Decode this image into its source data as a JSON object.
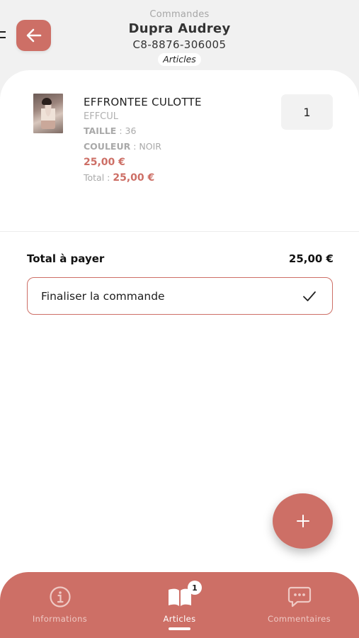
{
  "header": {
    "subtitle": "Commandes",
    "customer_name": "Dupra Audrey",
    "order_ref": "C8-8876-306005",
    "section_chip": "Articles"
  },
  "icons": {
    "back": "arrow-left-icon",
    "menu": "menu-icon",
    "check": "check-icon",
    "add": "plus-icon",
    "info": "info-icon",
    "articles": "book-icon",
    "comments": "chat-icon"
  },
  "colors": {
    "accent": "#cd6f66",
    "background": "#f1f1f1",
    "card": "#ffffff"
  },
  "items": [
    {
      "title": "EFFRONTEE CULOTTE",
      "code": "EFFCUL",
      "size_label": "TAILLE",
      "size_value": "36",
      "color_label": "COULEUR",
      "color_value": "NOIR",
      "price": "25,00 €",
      "total_label": "Total :",
      "total_value": "25,00 €",
      "quantity": "1"
    }
  ],
  "summary": {
    "total_label": "Total à payer",
    "total_value": "25,00 €",
    "finalize_label": "Finaliser la commande"
  },
  "nav": {
    "items": [
      {
        "label": "Informations",
        "icon": "info-icon",
        "active": false
      },
      {
        "label": "Articles",
        "icon": "book-icon",
        "active": true,
        "badge": "1"
      },
      {
        "label": "Commentaires",
        "icon": "chat-icon",
        "active": false
      }
    ]
  }
}
